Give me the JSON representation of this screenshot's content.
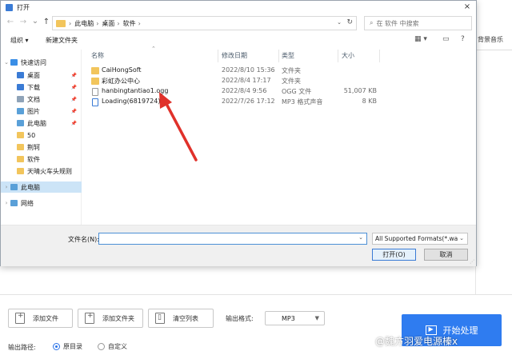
{
  "dialog": {
    "title": "打开",
    "close_glyph": "×",
    "nav": {
      "back": "←",
      "forward": "→",
      "recent": "⌄",
      "up": "↑"
    },
    "breadcrumb": [
      "此电脑",
      "桌面",
      "软件"
    ],
    "breadcrumb_sep": "›",
    "search_placeholder": "在 软件 中搜索",
    "toolbar": {
      "organize": "组织 ▾",
      "new_folder": "新建文件夹",
      "view_glyph": "▦ ▾",
      "pane_glyph": "▭",
      "help_glyph": "?"
    },
    "nav_items": [
      {
        "label": "快速访问",
        "icon": "star-icon",
        "color": "#3a8ee6",
        "chevron": "⌄",
        "pinned": false,
        "selected": false
      },
      {
        "label": "桌面",
        "icon": "desktop-icon",
        "color": "#3a7bd5",
        "chevron": "",
        "pinned": true,
        "selected": false
      },
      {
        "label": "下载",
        "icon": "download-icon",
        "color": "#3a7bd5",
        "chevron": "",
        "pinned": true,
        "selected": false
      },
      {
        "label": "文档",
        "icon": "document-icon",
        "color": "#8fa3b8",
        "chevron": "",
        "pinned": true,
        "selected": false
      },
      {
        "label": "图片",
        "icon": "picture-icon",
        "color": "#5aa0d8",
        "chevron": "",
        "pinned": true,
        "selected": false
      },
      {
        "label": "此电脑",
        "icon": "computer-icon",
        "color": "#5aa0d8",
        "chevron": "",
        "pinned": true,
        "selected": false
      },
      {
        "label": "50",
        "icon": "folder-icon",
        "color": "#f2c55c",
        "chevron": "",
        "pinned": false,
        "selected": false
      },
      {
        "label": "荆轲",
        "icon": "folder-icon",
        "color": "#f2c55c",
        "chevron": "",
        "pinned": false,
        "selected": false
      },
      {
        "label": "软件",
        "icon": "folder-icon",
        "color": "#f2c55c",
        "chevron": "",
        "pinned": false,
        "selected": false
      },
      {
        "label": "天晴火车头规则",
        "icon": "folder-icon",
        "color": "#f2c55c",
        "chevron": "",
        "pinned": false,
        "selected": false
      },
      {
        "label": "此电脑",
        "icon": "computer-icon",
        "color": "#5aa0d8",
        "chevron": "›",
        "pinned": false,
        "selected": true
      },
      {
        "label": "网络",
        "icon": "network-icon",
        "color": "#5aa0d8",
        "chevron": "›",
        "pinned": false,
        "selected": false
      }
    ],
    "pin_glyph": "📌",
    "columns": {
      "name": "名称",
      "date": "修改日期",
      "type": "类型",
      "size": "大小"
    },
    "files": [
      {
        "name": "CaiHongSoft",
        "date": "2022/8/10 15:36",
        "type": "文件夹",
        "size": "",
        "icon": "folder-icon",
        "color": "#f2c55c"
      },
      {
        "name": "彩虹办公中心",
        "date": "2022/8/4 17:17",
        "type": "文件夹",
        "size": "",
        "icon": "folder-icon",
        "color": "#f2c55c"
      },
      {
        "name": "hanbingtantiao1.ogg",
        "date": "2022/8/4 9:56",
        "type": "OGG 文件",
        "size": "51,007 KB",
        "icon": "file-icon",
        "color": "#ffffff"
      },
      {
        "name": "Loading(6819724)",
        "date": "2022/7/26 17:12",
        "type": "MP3 格式声音",
        "size": "8 KB",
        "icon": "audio-file-icon",
        "color": "#3a7bd5"
      }
    ],
    "filename_label": "文件名(N):",
    "filename_value": "",
    "filter_value": "All Supported Formats(*.wav",
    "open_label": "打开(O)",
    "cancel_label": "取消"
  },
  "app": {
    "bg_music_label": "背景音乐",
    "add_file": "添加文件",
    "add_folder": "添加文件夹",
    "clear_list": "清空列表",
    "output_format_label": "输出格式:",
    "output_format_value": "MP3",
    "output_path_label": "输出路径:",
    "radio_original": "原目录",
    "radio_custom": "自定义",
    "start_label": "开始处理",
    "watermark": "@魏方羽爱电源榛x"
  },
  "colors": {
    "accent": "#2f7cf0",
    "folder": "#f2c55c",
    "selection": "#cce4f7",
    "annotation": "#e0312a"
  }
}
